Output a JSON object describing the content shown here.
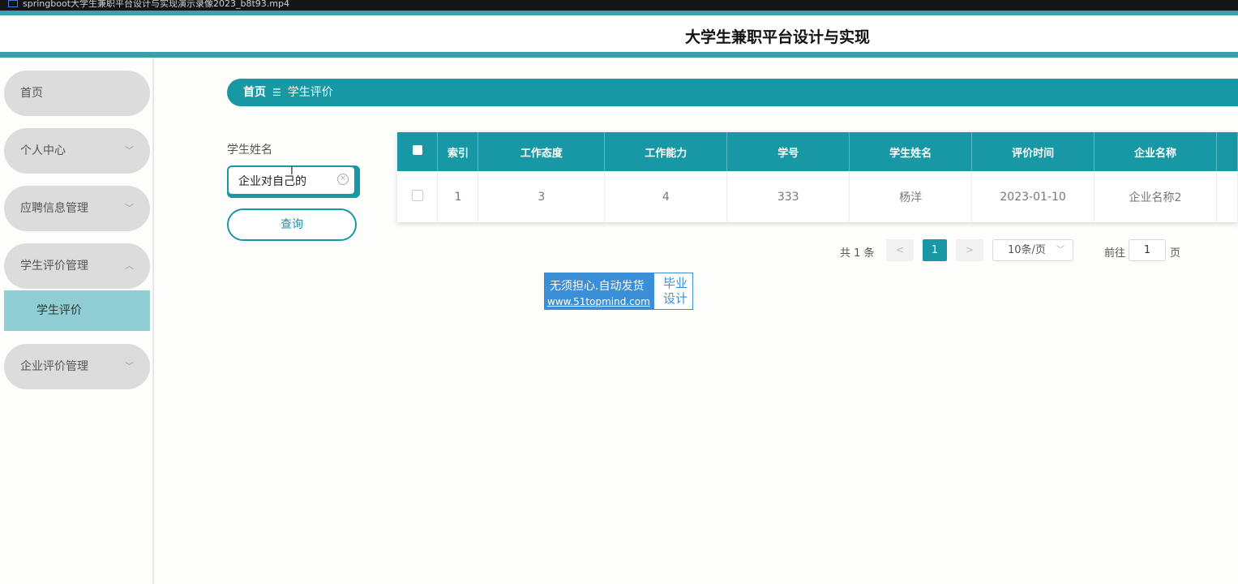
{
  "window": {
    "title": "springboot大学生兼职平台设计与实现演示录像2023_b8t93.mp4"
  },
  "header": {
    "site_title": "大学生兼职平台设计与实现"
  },
  "sidebar": {
    "items": [
      {
        "label": "首页",
        "has_chevron": false
      },
      {
        "label": "个人中心",
        "chevron": "﹀"
      },
      {
        "label": "应聘信息管理",
        "chevron": "﹀"
      },
      {
        "label": "学生评价管理",
        "chevron": "︿"
      },
      {
        "label": "企业评价管理",
        "chevron": "﹀"
      }
    ],
    "submenu": {
      "label": "学生评价"
    }
  },
  "breadcrumb": {
    "home": "首页",
    "separator": "☰",
    "current": "学生评价"
  },
  "search": {
    "label": "学生姓名",
    "value": "企业对自己的",
    "query_button": "查询"
  },
  "table": {
    "columns": [
      "索引",
      "工作态度",
      "工作能力",
      "学号",
      "学生姓名",
      "评价时间",
      "企业名称"
    ],
    "rows": [
      [
        "1",
        "3",
        "4",
        "333",
        "杨洋",
        "2023-01-10",
        "企业名称2"
      ]
    ]
  },
  "pagination": {
    "total": "共 1 条",
    "prev": "<",
    "current_page": "1",
    "next": ">",
    "page_size": "10条/页",
    "goto_prefix": "前往",
    "goto_value": "1",
    "goto_suffix": "页"
  },
  "watermark": {
    "line1": "无须担心.自动发货",
    "line2": "www.51topmind.com",
    "right_text": "毕业设计"
  },
  "colors": {
    "accent": "#1897a4",
    "header_bar": "#3aa0aa",
    "menu_bg": "#dcdcdc",
    "submenu_bg": "#8fcfd4"
  }
}
